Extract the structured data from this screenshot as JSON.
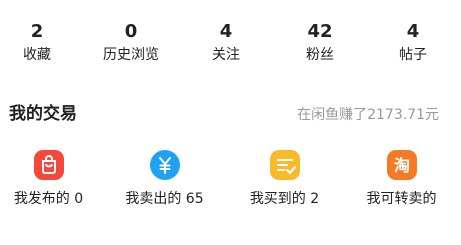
{
  "stats": [
    {
      "value": "2",
      "label": "收藏"
    },
    {
      "value": "0",
      "label": "历史浏览"
    },
    {
      "value": "4",
      "label": "关注"
    },
    {
      "value": "42",
      "label": "粉丝"
    },
    {
      "value": "4",
      "label": "帖子"
    }
  ],
  "trade": {
    "title": "我的交易",
    "earnings": "在闲鱼赚了2173.71元",
    "items": [
      {
        "label": "我发布的 0",
        "icon": "shopping-bag-icon",
        "color": "#F5483B"
      },
      {
        "label": "我卖出的 65",
        "icon": "yen-coin-icon",
        "color": "#1FA2F2"
      },
      {
        "label": "我买到的 2",
        "icon": "order-check-icon",
        "color": "#F8B92A"
      },
      {
        "label": "我可转卖的",
        "icon": "tao-resell-icon",
        "color": "#F47A25",
        "glyph": "淘"
      }
    ]
  }
}
